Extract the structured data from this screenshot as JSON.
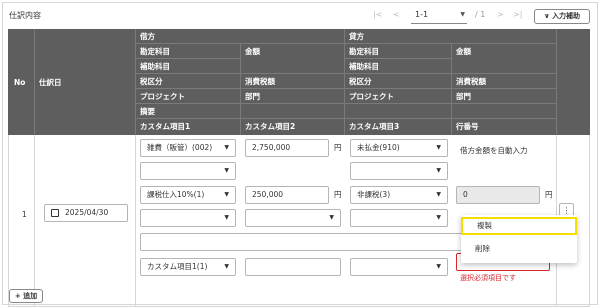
{
  "header": {
    "title": "仕訳内容",
    "pager": {
      "first": "|<",
      "prev": "<",
      "range": "1-1",
      "total": "/ 1",
      "next": ">",
      "last": ">|"
    },
    "assist_button": "入力補助",
    "assist_caret": "∨"
  },
  "columns": {
    "no": "No",
    "date": "仕訳日",
    "debit": "借方",
    "credit": "貸方",
    "account": "勘定科目",
    "amount": "金額",
    "sub_account": "補助科目",
    "tax_class": "税区分",
    "tax_amount": "消費税額",
    "project": "プロジェクト",
    "department": "部門",
    "memo": "摘要",
    "custom1": "カスタム項目1",
    "custom2": "カスタム項目2",
    "custom3": "カスタム項目3",
    "line_no": "行番号"
  },
  "row": {
    "no": "1",
    "date": "2025/04/30",
    "debit_account": "雑費（販管）(002)",
    "debit_amount": "2,750,000",
    "credit_account": "未払金(910)",
    "auto_amount_note": "借方金額を自動入力",
    "debit_tax_class": "課税仕入10%(1)",
    "debit_tax_amount": "250,000",
    "credit_tax_class": "非課税(3)",
    "credit_tax_amount": "0",
    "custom1_value": "カスタム項目1(1)",
    "required_error": "選択必須項目です",
    "yen": "円"
  },
  "menu": {
    "copy": "複製",
    "delete": "削除"
  },
  "add_button": "追加",
  "kebab": "⋮",
  "colors": {
    "header_bg": "#5e5e5e",
    "highlight": "#f3e000",
    "error": "#d9252c"
  }
}
